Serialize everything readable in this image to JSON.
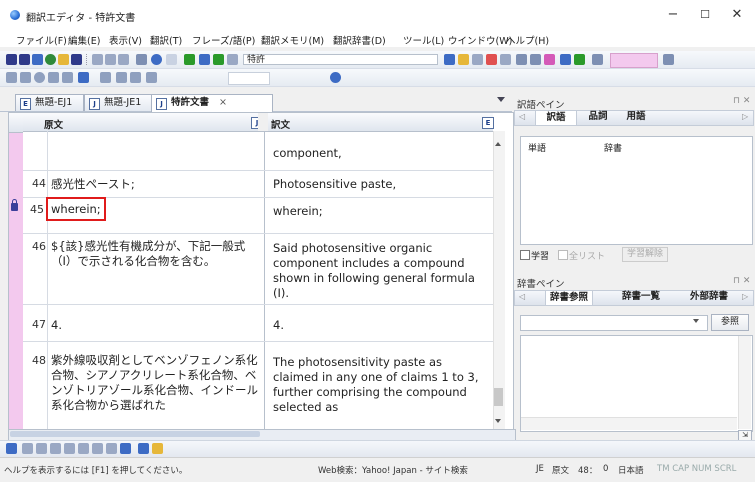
{
  "window": {
    "title": "翻訳エディタ - 特許文書",
    "minimize": "−",
    "maximize": "☐",
    "close": "✕"
  },
  "menu": [
    "ファイル(F)",
    "編集(E)",
    "表示(V)",
    "翻訳(T)",
    "フレーズ/語(P)",
    "翻訳メモリ(M)",
    "翻訳辞書(D)",
    "ツール(L)",
    "ウインドウ(W)",
    "ヘルプ(H)"
  ],
  "toolbar": {
    "search_box": "特許"
  },
  "tabs": [
    {
      "label": "無題-EJ1",
      "icon": "E"
    },
    {
      "label": "無題-JE1",
      "icon": "J"
    },
    {
      "label": "特許文書",
      "icon": "J",
      "close": "×"
    }
  ],
  "editor": {
    "source_header": "原文",
    "target_header": "訳文",
    "source_header_button": "J",
    "target_header_button": "E",
    "rows": [
      {
        "num": "",
        "source": "",
        "target": "component,"
      },
      {
        "num": "44",
        "source": "感光性ペースト;",
        "target": "Photosensitive paste,"
      },
      {
        "num": "45",
        "source": "wherein;",
        "target": "wherein;"
      },
      {
        "num": "46",
        "source": "${該}感光性有機成分が、下記一般式（I）で示される化合物を含む。",
        "target": "Said photosensitive organic component includes a compound shown in following general formula (I)."
      },
      {
        "num": "47",
        "source": "4.",
        "target": "4."
      },
      {
        "num": "48",
        "source": "紫外線吸収剤としてベンゾフェノン系化合物、シアノアクリレート系化合物、ベンゾトリアゾール系化合物、インドール系化合物から選ばれた",
        "target": "The photosensitivity paste as claimed in any one of claims 1 to 3, further comprising the compound selected as"
      }
    ]
  },
  "translation_pane": {
    "title": "訳語ペイン",
    "tabs": [
      "訳語",
      "品詞",
      "用語"
    ],
    "col_word": "単語",
    "col_dict": "辞書",
    "learn_checkbox": "学習",
    "all_list_checkbox": "全リスト",
    "learn_cancel_button": "学習解除"
  },
  "dictionary_pane": {
    "title": "辞書ペイン",
    "tabs": [
      "辞書参照",
      "辞書一覧",
      "外部辞書"
    ],
    "reference_button": "参照"
  },
  "status": {
    "help": "ヘルプを表示するには [F1] を押してください。",
    "web_search": "Web検索：Yahoo! Japan - サイト検索",
    "direction": "JE",
    "source_label": "原文",
    "position": "48：",
    "count": "0",
    "language": "日本語",
    "modes": "TM  CAP NUM SCRL"
  },
  "colors": {
    "accent_pink": "#f3c9ee",
    "highlight_red": "#e01b1b"
  }
}
